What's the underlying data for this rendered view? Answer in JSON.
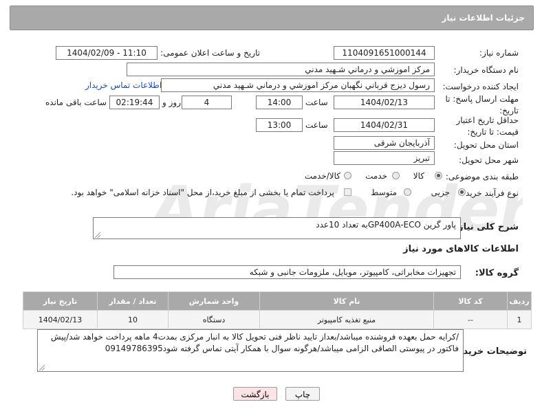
{
  "header": {
    "title": "جزئیات اطلاعات نیاز"
  },
  "need_number": {
    "label": "شماره نیاز:",
    "value": "1104091651000144"
  },
  "announce": {
    "label": "تاریخ و ساعت اعلان عمومی:",
    "value": "1404/02/09 - 11:10"
  },
  "buyer": {
    "label": "نام دستگاه خریدار:",
    "value": "مرکز اموزشي و درماني شـهيد مدني"
  },
  "creator": {
    "label": "ایجاد کننده درخواست:",
    "value": "رسول ديزج قرباني نگهبان مرکز اموزشي و درماني شـهيد مدني",
    "contact_link": "اطلاعات تماس خریدار"
  },
  "reply_deadline": {
    "label": "مهلت ارسال پاسخ: تا تاریخ:",
    "date": "1404/02/13",
    "time_label": "ساعت",
    "time": "14:00",
    "days": "4",
    "days_label": "روز و",
    "remaining": "02:19:44",
    "remaining_label": "ساعت باقی مانده"
  },
  "price_deadline": {
    "label": "حداقل تاریخ اعتبار قیمت: تا تاریخ:",
    "date": "1404/02/31",
    "time_label": "ساعت",
    "time": "13:00"
  },
  "province": {
    "label": "استان محل تحویل:",
    "value": "آذربایجان شرقی"
  },
  "city": {
    "label": "شهر محل تحویل:",
    "value": "تبریز"
  },
  "category": {
    "label": "طبقه بندی موضوعی:",
    "options": [
      "کالا",
      "خدمت",
      "کالا/خدمت"
    ],
    "selected": "کالا"
  },
  "process": {
    "label": "نوع فرآیند خرید :",
    "options": [
      "جزیی",
      "متوسط"
    ],
    "selected": "جزیی",
    "note": "پرداخت تمام یا بخشی از مبلغ خرید،از محل \"اسناد خزانه اسلامی\" خواهد بود."
  },
  "description": {
    "label": "شرح کلی نیاز:",
    "value": "پاور گرین GP400A-ECOبه تعداد 10عدد"
  },
  "goods_info": {
    "title": "اطلاعات کالاهای مورد نیاز"
  },
  "goods_group": {
    "label": "گروه کالا:",
    "value": "تجهیزات مخابراتی، کامپیوتر، موبایل، ملزومات جانبی و شبکه"
  },
  "table": {
    "headers": [
      "ردیف",
      "کد کالا",
      "نام کالا",
      "واحد شمارش",
      "تعداد / مقدار",
      "تاریخ نیاز"
    ],
    "rows": [
      [
        "1",
        "--",
        "منبع تغذیه کامپیوتر",
        "دستگاه",
        "10",
        "1404/02/13"
      ]
    ]
  },
  "buyer_notes": {
    "label": "توضیحات خریدار:",
    "value": "/کرایه حمل بعهده فروشنده میباشد/بعداز تایید ناظر فنی تحویل کالا به انبار مرکزی بمدت4 ماهه پرداخت خواهد شد/پیش فاکتور در پیوستی الصاقی الزامی میباشد/هرگونه سوال با همکار آیتی تماس گرفته شود09149786395"
  },
  "buttons": {
    "print": "چاپ",
    "back": "بازگشت"
  },
  "watermark": {
    "text": "AriaTender.neT"
  },
  "colors": {
    "header_bg": "#a9a9a9",
    "link": "#1a4fa8",
    "back_bg": "#fde4e4"
  }
}
